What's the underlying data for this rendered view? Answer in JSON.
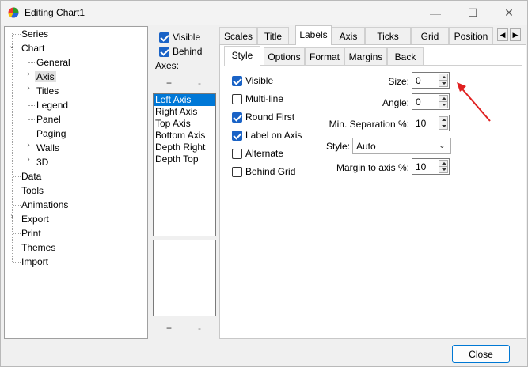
{
  "window": {
    "title": "Editing Chart1",
    "minimize_glyph": "—",
    "maximize_glyph": "☐",
    "close_glyph": "✕"
  },
  "tree": {
    "items": [
      {
        "label": "Series",
        "level": 0
      },
      {
        "label": "Chart",
        "level": 0,
        "expanded": true
      },
      {
        "label": "General",
        "level": 1
      },
      {
        "label": "Axis",
        "level": 1,
        "selected": true
      },
      {
        "label": "Titles",
        "level": 1
      },
      {
        "label": "Legend",
        "level": 1
      },
      {
        "label": "Panel",
        "level": 1
      },
      {
        "label": "Paging",
        "level": 1
      },
      {
        "label": "Walls",
        "level": 1
      },
      {
        "label": "3D",
        "level": 1
      },
      {
        "label": "Data",
        "level": 0
      },
      {
        "label": "Tools",
        "level": 0
      },
      {
        "label": "Animations",
        "level": 0
      },
      {
        "label": "Export",
        "level": 0
      },
      {
        "label": "Print",
        "level": 0
      },
      {
        "label": "Themes",
        "level": 0
      },
      {
        "label": "Import",
        "level": 0
      }
    ]
  },
  "axes_panel": {
    "visible_label": "Visible",
    "behind_label": "Behind",
    "axes_label": "Axes:",
    "add_glyph": "+",
    "remove_glyph": "-",
    "axes_list": [
      "Left Axis",
      "Right Axis",
      "Top Axis",
      "Bottom Axis",
      "Depth Right",
      "Depth Top"
    ],
    "selected_axis": "Left Axis"
  },
  "tabs": [
    "Scales",
    "Title",
    "Labels",
    "Axis",
    "Ticks",
    "Grid",
    "Position"
  ],
  "active_tab": "Labels",
  "tab_scroll": {
    "left": "◀",
    "right": "▶"
  },
  "subtabs": [
    "Style",
    "Options",
    "Format",
    "Margins",
    "Back"
  ],
  "active_subtab": "Style",
  "options": [
    {
      "label": "Visible",
      "checked": true
    },
    {
      "label": "Multi-line",
      "checked": false
    },
    {
      "label": "Round First",
      "checked": true
    },
    {
      "label": "Label on Axis",
      "checked": true
    },
    {
      "label": "Alternate",
      "checked": false
    },
    {
      "label": "Behind Grid",
      "checked": false
    }
  ],
  "fields": {
    "size_label": "Size:",
    "size_value": "0",
    "angle_label": "Angle:",
    "angle_value": "0",
    "min_sep_label": "Min. Separation %:",
    "min_sep_value": "10",
    "style_label": "Style:",
    "style_value": "Auto",
    "margin_label": "Margin to axis %:",
    "margin_value": "10"
  },
  "close_label": "Close",
  "colors": {
    "accent": "#0078d7",
    "checkbox": "#1a63c6",
    "annotation_arrow": "#e02020"
  }
}
